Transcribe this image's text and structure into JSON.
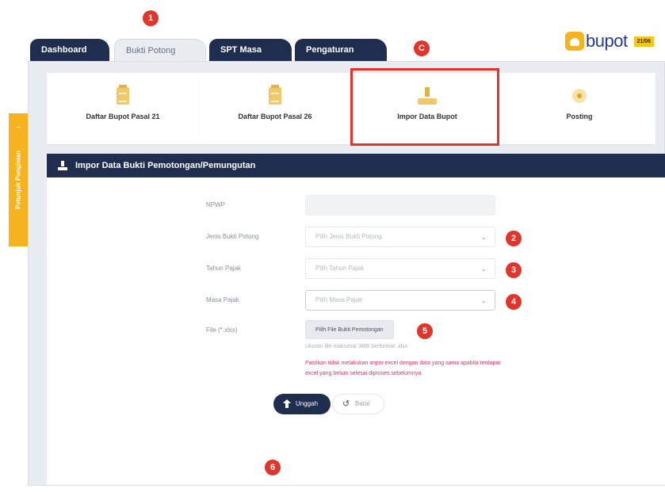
{
  "tabs": [
    {
      "label": "Dashboard"
    },
    {
      "label": "Bukti Potong"
    },
    {
      "label": "SPT Masa"
    },
    {
      "label": "Pengaturan"
    }
  ],
  "logo": {
    "text": "bupot",
    "date": "21/06"
  },
  "side_tab": {
    "label": "Petunjuk Pengisian",
    "arrow": "→"
  },
  "cards": [
    {
      "label": "Daftar Bupot Pasal 21",
      "icon": "document-icon"
    },
    {
      "label": "Daftar Bupot Pasal 26",
      "icon": "document-icon"
    },
    {
      "label": "Impor Data Bupot",
      "icon": "import-icon"
    },
    {
      "label": "Posting",
      "icon": "posting-icon"
    }
  ],
  "panel": {
    "title": "Impor Data Bukti Pemotongan/Pemungutan"
  },
  "form": {
    "npwp": {
      "label": "NPWP",
      "value": ""
    },
    "jenis": {
      "label": "Jenis Bukti Potong",
      "placeholder": "Pilih Jenis Bukti Potong"
    },
    "tahun": {
      "label": "Tahun Pajak",
      "placeholder": "Pilih Tahun Pajak"
    },
    "masa": {
      "label": "Masa Pajak",
      "placeholder": "Pilih Masa Pajak"
    },
    "file": {
      "label": "File (*.xlsx)",
      "button": "Pilih File Bukti Pemotongan",
      "hint": "Ukuran file maksimal 3MB berformat .xlsx",
      "warning": "Pastikan tidak melakukan impor excel dengan data yang sama apabila terdapat excel yang belum selesai diproses sebelumnya"
    }
  },
  "actions": {
    "upload": "Unggah",
    "cancel": "Batal"
  },
  "markers": {
    "m1": "1",
    "m2": "2",
    "m3": "3",
    "m4": "4",
    "m5": "5",
    "m6": "6",
    "mc": "C"
  },
  "colors": {
    "navy": "#1f2d4e",
    "accent": "#f5b320",
    "marker": "#e0352b",
    "warning": "#d6336c"
  }
}
